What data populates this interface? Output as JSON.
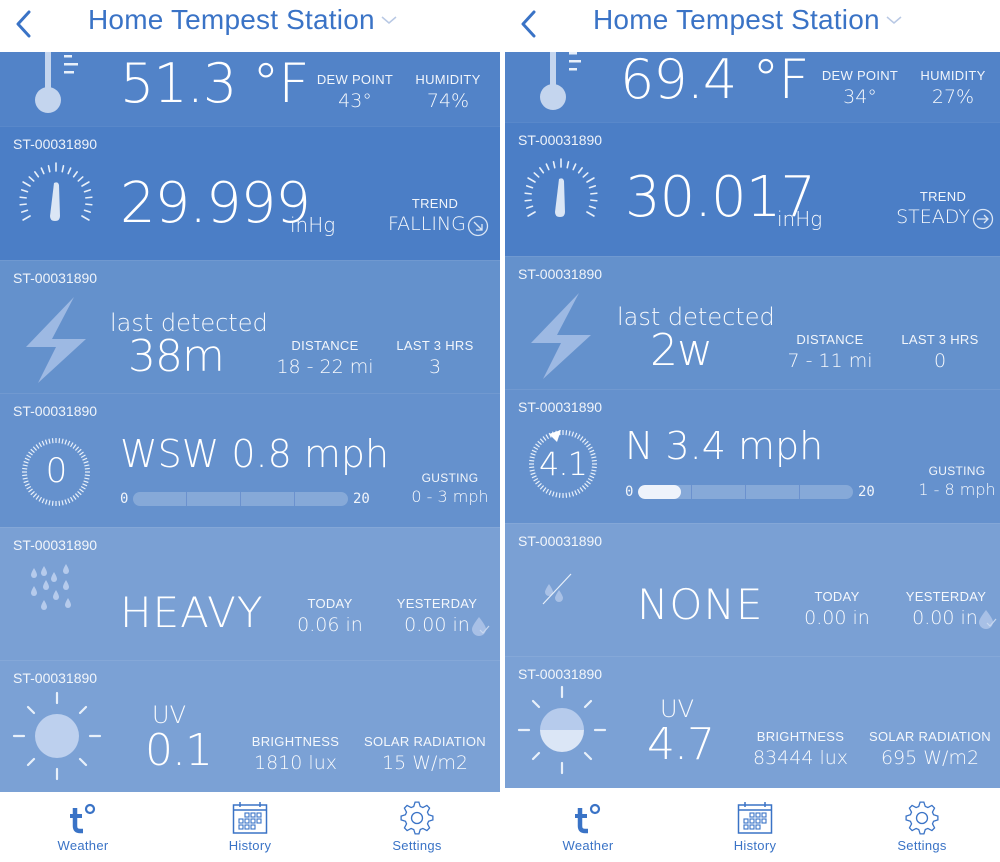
{
  "colors": {
    "accent": "#3a73c6",
    "temp_panel": "#5283c8",
    "pressure_panel": "#4b7ec6",
    "lightning_panel": "#6491cc",
    "wind_panel": "#6591cd",
    "rain_panel": "#7aa0d4",
    "uv_panel": "#7ba1d5"
  },
  "tabs": [
    {
      "label": "Weather",
      "icon": "tempest-logo-icon"
    },
    {
      "label": "History",
      "icon": "calendar-icon"
    },
    {
      "label": "Settings",
      "icon": "gear-icon"
    }
  ],
  "screens": [
    {
      "header": {
        "title": "Home Tempest Station",
        "back_icon": "chevron-left-icon",
        "dropdown_icon": "chevron-down-icon"
      },
      "temperature": {
        "value": "51.3 °F",
        "dew_point_label": "DEW POINT",
        "dew_point": "43°",
        "humidity_label": "HUMIDITY",
        "humidity": "74%"
      },
      "pressure": {
        "station_id": "ST-00031890",
        "value": "29.999",
        "unit": "inHg",
        "trend_label": "TREND",
        "trend": "FALLING",
        "trend_icon": "arrow-down-right-circle-icon"
      },
      "lightning": {
        "station_id": "ST-00031890",
        "caption": "last detected",
        "value": "38m",
        "distance_label": "DISTANCE",
        "distance": "18 - 22 mi",
        "last3_label": "LAST 3 HRS",
        "last3": "3"
      },
      "wind": {
        "station_id": "ST-00031890",
        "dial_value": "0",
        "value": "WSW 0.8 mph",
        "bar_min": "0",
        "bar_max": "20",
        "speed_fraction": 0.0,
        "gusting_label": "GUSTING",
        "gusting": "0 - 3 mph",
        "dial_arrow": false
      },
      "rain": {
        "station_id": "ST-00031890",
        "value": "HEAVY",
        "today_label": "TODAY",
        "today": "0.06 in",
        "yesterday_label": "YESTERDAY",
        "yesterday": "0.00 in",
        "icon": "heavy-rain-icon"
      },
      "uv": {
        "station_id": "ST-00031890",
        "uv_label": "UV",
        "value": "0.1",
        "brightness_label": "BRIGHTNESS",
        "brightness": "1810 lux",
        "solar_label": "SOLAR RADIATION",
        "solar": "15 W/m2"
      }
    },
    {
      "header": {
        "title": "Home Tempest Station",
        "back_icon": "chevron-left-icon",
        "dropdown_icon": "chevron-down-icon"
      },
      "temperature": {
        "value": "69.4 °F",
        "dew_point_label": "DEW POINT",
        "dew_point": "34°",
        "humidity_label": "HUMIDITY",
        "humidity": "27%"
      },
      "pressure": {
        "station_id": "ST-00031890",
        "value": "30.017",
        "unit": "inHg",
        "trend_label": "TREND",
        "trend": "STEADY",
        "trend_icon": "arrow-right-circle-icon"
      },
      "lightning": {
        "station_id": "ST-00031890",
        "caption": "last detected",
        "value": "2w",
        "distance_label": "DISTANCE",
        "distance": "7 - 11 mi",
        "last3_label": "LAST 3 HRS",
        "last3": "0"
      },
      "wind": {
        "station_id": "ST-00031890",
        "dial_value": "4.1",
        "value": "N 3.4 mph",
        "bar_min": "0",
        "bar_max": "20",
        "speed_fraction": 0.2,
        "gusting_label": "GUSTING",
        "gusting": "1 - 8 mph",
        "dial_arrow": true
      },
      "rain": {
        "station_id": "ST-00031890",
        "value": "NONE",
        "today_label": "TODAY",
        "today": "0.00 in",
        "yesterday_label": "YESTERDAY",
        "yesterday": "0.00 in",
        "icon": "no-rain-icon"
      },
      "uv": {
        "station_id": "ST-00031890",
        "uv_label": "UV",
        "value": "4.7",
        "brightness_label": "BRIGHTNESS",
        "brightness": "83444 lux",
        "solar_label": "SOLAR RADIATION",
        "solar": "695 W/m2"
      }
    }
  ]
}
